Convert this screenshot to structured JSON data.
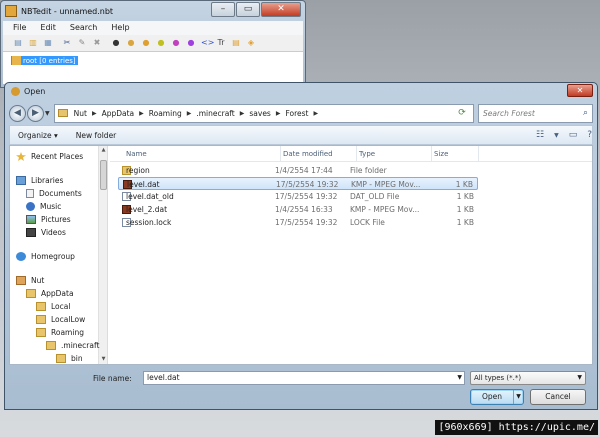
{
  "nbtedit": {
    "title": "NBTedit - unnamed.nbt",
    "menu": [
      "File",
      "Edit",
      "Search",
      "Help"
    ],
    "tree_root": "root [0 entries]",
    "toolbar_icons": [
      "new-icon",
      "open-icon",
      "save-icon",
      "cut-icon",
      "edit-icon",
      "delete-icon",
      "byte-tag-icon",
      "short-tag-icon",
      "int-tag-icon",
      "long-tag-icon",
      "float-tag-icon",
      "double-tag-icon",
      "byte-array-tag-icon",
      "string-tag-icon",
      "list-tag-icon",
      "compound-tag-icon"
    ],
    "toolbar_glyphs": [
      "▤",
      "▥",
      "▦",
      "✂",
      "✎",
      "✖",
      "●",
      "●",
      "●",
      "●",
      "●",
      "●",
      "<>",
      "Tr",
      "▤",
      "◈"
    ],
    "toolbar_colors": [
      "#6d8fb8",
      "#d9a640",
      "#6d8fb8",
      "#3e5a8c",
      "#888888",
      "#999999",
      "#333333",
      "#d9a640",
      "#e0a030",
      "#c0c020",
      "#c040c0",
      "#a040e0",
      "#3355cc",
      "#444444",
      "#e0a030",
      "#e0a030"
    ]
  },
  "dialog": {
    "title": "Open",
    "close": "✕",
    "breadcrumbs": [
      "Nut",
      "AppData",
      "Roaming",
      ".minecraft",
      "saves",
      "Forest"
    ],
    "search_placeholder": "Search Forest",
    "organize": "Organize ▾",
    "new_folder": "New folder",
    "columns": {
      "name": "Name",
      "date": "Date modified",
      "type": "Type",
      "size": "Size"
    },
    "nav": [
      {
        "label": "Recent Places",
        "icon": "star"
      },
      {
        "label": "Libraries",
        "icon": "lib"
      },
      {
        "label": "Documents",
        "icon": "doc"
      },
      {
        "label": "Music",
        "icon": "music"
      },
      {
        "label": "Pictures",
        "icon": "pic"
      },
      {
        "label": "Videos",
        "icon": "vid"
      },
      {
        "label": "Homegroup",
        "icon": "home"
      },
      {
        "label": "Nut",
        "icon": "user"
      },
      {
        "label": "AppData",
        "icon": "fold"
      },
      {
        "label": "Local",
        "icon": "fold"
      },
      {
        "label": "LocalLow",
        "icon": "fold"
      },
      {
        "label": "Roaming",
        "icon": "fold"
      },
      {
        "label": ".minecraft",
        "icon": "fold"
      },
      {
        "label": "bin",
        "icon": "fold"
      }
    ],
    "files": [
      {
        "name": "region",
        "date": "1/4/2554 17:44",
        "type": "File folder",
        "size": "",
        "icon": "fold"
      },
      {
        "name": "level.dat",
        "date": "17/5/2554 19:32",
        "type": "KMP - MPEG Mov...",
        "size": "1 KB",
        "icon": "kmp"
      },
      {
        "name": "level.dat_old",
        "date": "17/5/2554 19:32",
        "type": "DAT_OLD File",
        "size": "1 KB",
        "icon": "gen"
      },
      {
        "name": "level_2.dat",
        "date": "1/4/2554 16:33",
        "type": "KMP - MPEG Mov...",
        "size": "1 KB",
        "icon": "kmp"
      },
      {
        "name": "session.lock",
        "date": "17/5/2554 19:32",
        "type": "LOCK File",
        "size": "1 KB",
        "icon": "gen"
      }
    ],
    "filename_label": "File name:",
    "filename_value": "level.dat",
    "filetype": "All types (*.*)",
    "open_label": "Open",
    "cancel_label": "Cancel"
  },
  "watermark": "[960x669] https://upic.me/"
}
